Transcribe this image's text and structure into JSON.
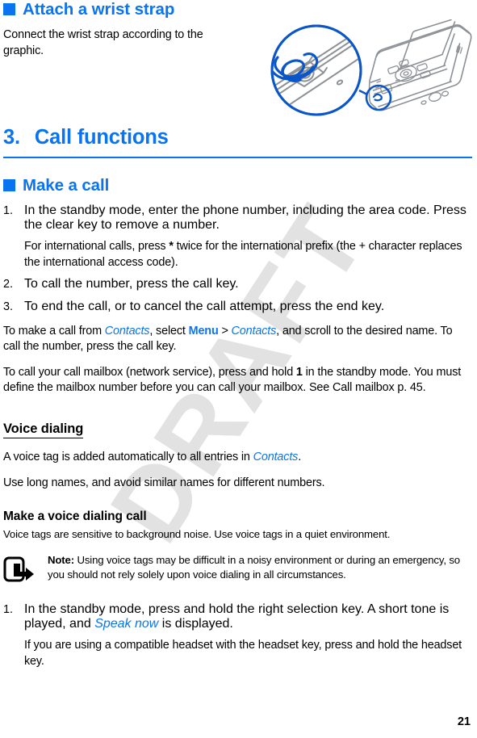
{
  "page": {
    "number": "21",
    "watermark": "DRAFT",
    "accent_color": "#0a74f0",
    "text_color": "#000000",
    "watermark_color": "#e2e2e2"
  },
  "wrist_strap": {
    "heading": "Attach a wrist strap",
    "bullet_icon": "square-bullet-icon",
    "body": "Connect the wrist strap according to the graphic.",
    "graphic": {
      "name": "wrist-strap-attachment-illustration",
      "alt": "Line drawing of a mobile phone with a magnified circular callout showing a wrist strap threaded through the eyelet"
    }
  },
  "chapter": {
    "number": "3.",
    "title": "Call functions"
  },
  "make_a_call": {
    "heading": "Make a call",
    "bullet_icon": "square-bullet-icon",
    "steps": [
      {
        "num": "1.",
        "text_before": "In the standby mode, enter the phone number, including the area code. Press the clear key to remove a number.",
        "continuation_before": "For international calls, press ",
        "continuation_key": "*",
        "continuation_after": " twice for the international prefix (the + character replaces the international access code)."
      },
      {
        "num": "2.",
        "text_before": "To call the number, press the call key."
      },
      {
        "num": "3.",
        "text_before": "To end the call, or to cancel the call attempt, press the end key."
      }
    ],
    "paragraph_contacts": {
      "p1": "To make a call from ",
      "ui1": "Contacts",
      "p2": ", select ",
      "ui2": "Menu",
      "p3": " > ",
      "ui3": "Contacts",
      "p4": ", and scroll to the desired name. To call the number, press the call key."
    },
    "paragraph_mailbox": {
      "p1": "To call your call mailbox (network service), press and hold ",
      "key": "1",
      "p2": " in the standby mode. You must define the mailbox number before you can call your mailbox. See Call mailbox p. 45."
    }
  },
  "voice_dialing": {
    "heading": "Voice dialing ",
    "paragraph1": {
      "p1": "A voice tag is added automatically to all entries in ",
      "ui1": "Contacts",
      "p2": "."
    },
    "paragraph2": "Use long names, and avoid similar names for different numbers.",
    "make_call": {
      "heading": "Make a voice dialing call",
      "intro": "Voice tags are sensitive to background noise. Use voice tags in a quiet environment.",
      "note": {
        "icon": "note-hand-pointer-icon",
        "label": "Note:",
        "text": " Using voice tags may be difficult in a noisy environment or during an emergency, so you should not rely solely upon voice dialing in all circumstances."
      },
      "steps": [
        {
          "num": "1.",
          "p1": "In the standby mode, press and hold the right selection key. A short tone is played, and ",
          "ui1": "Speak now",
          "p2": " is displayed.",
          "continuation": "If you are using a compatible headset with the headset key, press and hold the headset key."
        }
      ]
    }
  }
}
